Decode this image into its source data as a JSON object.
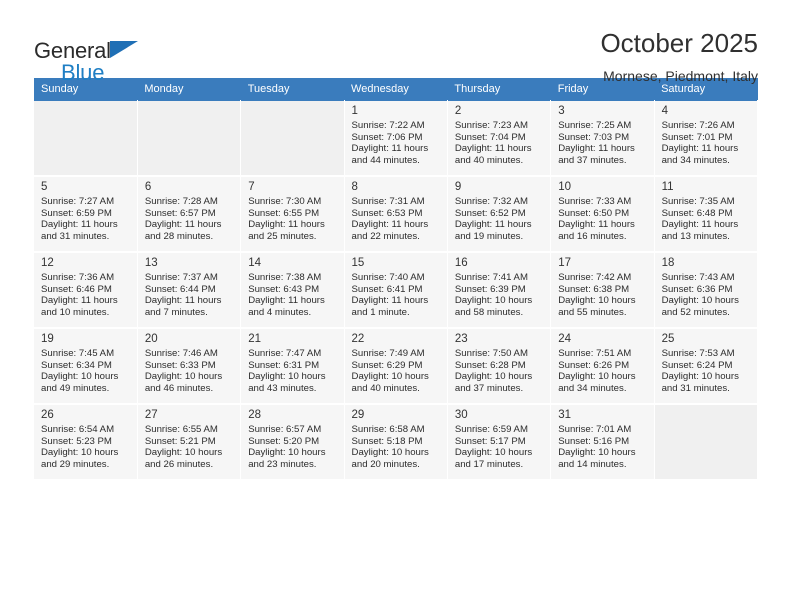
{
  "brand": {
    "name_top": "General",
    "name_bottom": "Blue",
    "accent_color": "#1f7fc4",
    "triangle_color": "#1f6fb5"
  },
  "header": {
    "title": "October 2025",
    "subtitle": "Mornese, Piedmont, Italy"
  },
  "calendar": {
    "header_bg": "#3a7cbd",
    "header_text_color": "#ffffff",
    "cell_bg": "#f6f6f6",
    "weekdays": [
      "Sunday",
      "Monday",
      "Tuesday",
      "Wednesday",
      "Thursday",
      "Friday",
      "Saturday"
    ],
    "weeks": [
      [
        {
          "day": "",
          "empty": true
        },
        {
          "day": "",
          "empty": true
        },
        {
          "day": "",
          "empty": true
        },
        {
          "day": "1",
          "sunrise": "Sunrise: 7:22 AM",
          "sunset": "Sunset: 7:06 PM",
          "daylight1": "Daylight: 11 hours",
          "daylight2": "and 44 minutes."
        },
        {
          "day": "2",
          "sunrise": "Sunrise: 7:23 AM",
          "sunset": "Sunset: 7:04 PM",
          "daylight1": "Daylight: 11 hours",
          "daylight2": "and 40 minutes."
        },
        {
          "day": "3",
          "sunrise": "Sunrise: 7:25 AM",
          "sunset": "Sunset: 7:03 PM",
          "daylight1": "Daylight: 11 hours",
          "daylight2": "and 37 minutes."
        },
        {
          "day": "4",
          "sunrise": "Sunrise: 7:26 AM",
          "sunset": "Sunset: 7:01 PM",
          "daylight1": "Daylight: 11 hours",
          "daylight2": "and 34 minutes."
        }
      ],
      [
        {
          "day": "5",
          "sunrise": "Sunrise: 7:27 AM",
          "sunset": "Sunset: 6:59 PM",
          "daylight1": "Daylight: 11 hours",
          "daylight2": "and 31 minutes."
        },
        {
          "day": "6",
          "sunrise": "Sunrise: 7:28 AM",
          "sunset": "Sunset: 6:57 PM",
          "daylight1": "Daylight: 11 hours",
          "daylight2": "and 28 minutes."
        },
        {
          "day": "7",
          "sunrise": "Sunrise: 7:30 AM",
          "sunset": "Sunset: 6:55 PM",
          "daylight1": "Daylight: 11 hours",
          "daylight2": "and 25 minutes."
        },
        {
          "day": "8",
          "sunrise": "Sunrise: 7:31 AM",
          "sunset": "Sunset: 6:53 PM",
          "daylight1": "Daylight: 11 hours",
          "daylight2": "and 22 minutes."
        },
        {
          "day": "9",
          "sunrise": "Sunrise: 7:32 AM",
          "sunset": "Sunset: 6:52 PM",
          "daylight1": "Daylight: 11 hours",
          "daylight2": "and 19 minutes."
        },
        {
          "day": "10",
          "sunrise": "Sunrise: 7:33 AM",
          "sunset": "Sunset: 6:50 PM",
          "daylight1": "Daylight: 11 hours",
          "daylight2": "and 16 minutes."
        },
        {
          "day": "11",
          "sunrise": "Sunrise: 7:35 AM",
          "sunset": "Sunset: 6:48 PM",
          "daylight1": "Daylight: 11 hours",
          "daylight2": "and 13 minutes."
        }
      ],
      [
        {
          "day": "12",
          "sunrise": "Sunrise: 7:36 AM",
          "sunset": "Sunset: 6:46 PM",
          "daylight1": "Daylight: 11 hours",
          "daylight2": "and 10 minutes."
        },
        {
          "day": "13",
          "sunrise": "Sunrise: 7:37 AM",
          "sunset": "Sunset: 6:44 PM",
          "daylight1": "Daylight: 11 hours",
          "daylight2": "and 7 minutes."
        },
        {
          "day": "14",
          "sunrise": "Sunrise: 7:38 AM",
          "sunset": "Sunset: 6:43 PM",
          "daylight1": "Daylight: 11 hours",
          "daylight2": "and 4 minutes."
        },
        {
          "day": "15",
          "sunrise": "Sunrise: 7:40 AM",
          "sunset": "Sunset: 6:41 PM",
          "daylight1": "Daylight: 11 hours",
          "daylight2": "and 1 minute."
        },
        {
          "day": "16",
          "sunrise": "Sunrise: 7:41 AM",
          "sunset": "Sunset: 6:39 PM",
          "daylight1": "Daylight: 10 hours",
          "daylight2": "and 58 minutes."
        },
        {
          "day": "17",
          "sunrise": "Sunrise: 7:42 AM",
          "sunset": "Sunset: 6:38 PM",
          "daylight1": "Daylight: 10 hours",
          "daylight2": "and 55 minutes."
        },
        {
          "day": "18",
          "sunrise": "Sunrise: 7:43 AM",
          "sunset": "Sunset: 6:36 PM",
          "daylight1": "Daylight: 10 hours",
          "daylight2": "and 52 minutes."
        }
      ],
      [
        {
          "day": "19",
          "sunrise": "Sunrise: 7:45 AM",
          "sunset": "Sunset: 6:34 PM",
          "daylight1": "Daylight: 10 hours",
          "daylight2": "and 49 minutes."
        },
        {
          "day": "20",
          "sunrise": "Sunrise: 7:46 AM",
          "sunset": "Sunset: 6:33 PM",
          "daylight1": "Daylight: 10 hours",
          "daylight2": "and 46 minutes."
        },
        {
          "day": "21",
          "sunrise": "Sunrise: 7:47 AM",
          "sunset": "Sunset: 6:31 PM",
          "daylight1": "Daylight: 10 hours",
          "daylight2": "and 43 minutes."
        },
        {
          "day": "22",
          "sunrise": "Sunrise: 7:49 AM",
          "sunset": "Sunset: 6:29 PM",
          "daylight1": "Daylight: 10 hours",
          "daylight2": "and 40 minutes."
        },
        {
          "day": "23",
          "sunrise": "Sunrise: 7:50 AM",
          "sunset": "Sunset: 6:28 PM",
          "daylight1": "Daylight: 10 hours",
          "daylight2": "and 37 minutes."
        },
        {
          "day": "24",
          "sunrise": "Sunrise: 7:51 AM",
          "sunset": "Sunset: 6:26 PM",
          "daylight1": "Daylight: 10 hours",
          "daylight2": "and 34 minutes."
        },
        {
          "day": "25",
          "sunrise": "Sunrise: 7:53 AM",
          "sunset": "Sunset: 6:24 PM",
          "daylight1": "Daylight: 10 hours",
          "daylight2": "and 31 minutes."
        }
      ],
      [
        {
          "day": "26",
          "sunrise": "Sunrise: 6:54 AM",
          "sunset": "Sunset: 5:23 PM",
          "daylight1": "Daylight: 10 hours",
          "daylight2": "and 29 minutes."
        },
        {
          "day": "27",
          "sunrise": "Sunrise: 6:55 AM",
          "sunset": "Sunset: 5:21 PM",
          "daylight1": "Daylight: 10 hours",
          "daylight2": "and 26 minutes."
        },
        {
          "day": "28",
          "sunrise": "Sunrise: 6:57 AM",
          "sunset": "Sunset: 5:20 PM",
          "daylight1": "Daylight: 10 hours",
          "daylight2": "and 23 minutes."
        },
        {
          "day": "29",
          "sunrise": "Sunrise: 6:58 AM",
          "sunset": "Sunset: 5:18 PM",
          "daylight1": "Daylight: 10 hours",
          "daylight2": "and 20 minutes."
        },
        {
          "day": "30",
          "sunrise": "Sunrise: 6:59 AM",
          "sunset": "Sunset: 5:17 PM",
          "daylight1": "Daylight: 10 hours",
          "daylight2": "and 17 minutes."
        },
        {
          "day": "31",
          "sunrise": "Sunrise: 7:01 AM",
          "sunset": "Sunset: 5:16 PM",
          "daylight1": "Daylight: 10 hours",
          "daylight2": "and 14 minutes."
        },
        {
          "day": "",
          "empty": true
        }
      ]
    ]
  }
}
